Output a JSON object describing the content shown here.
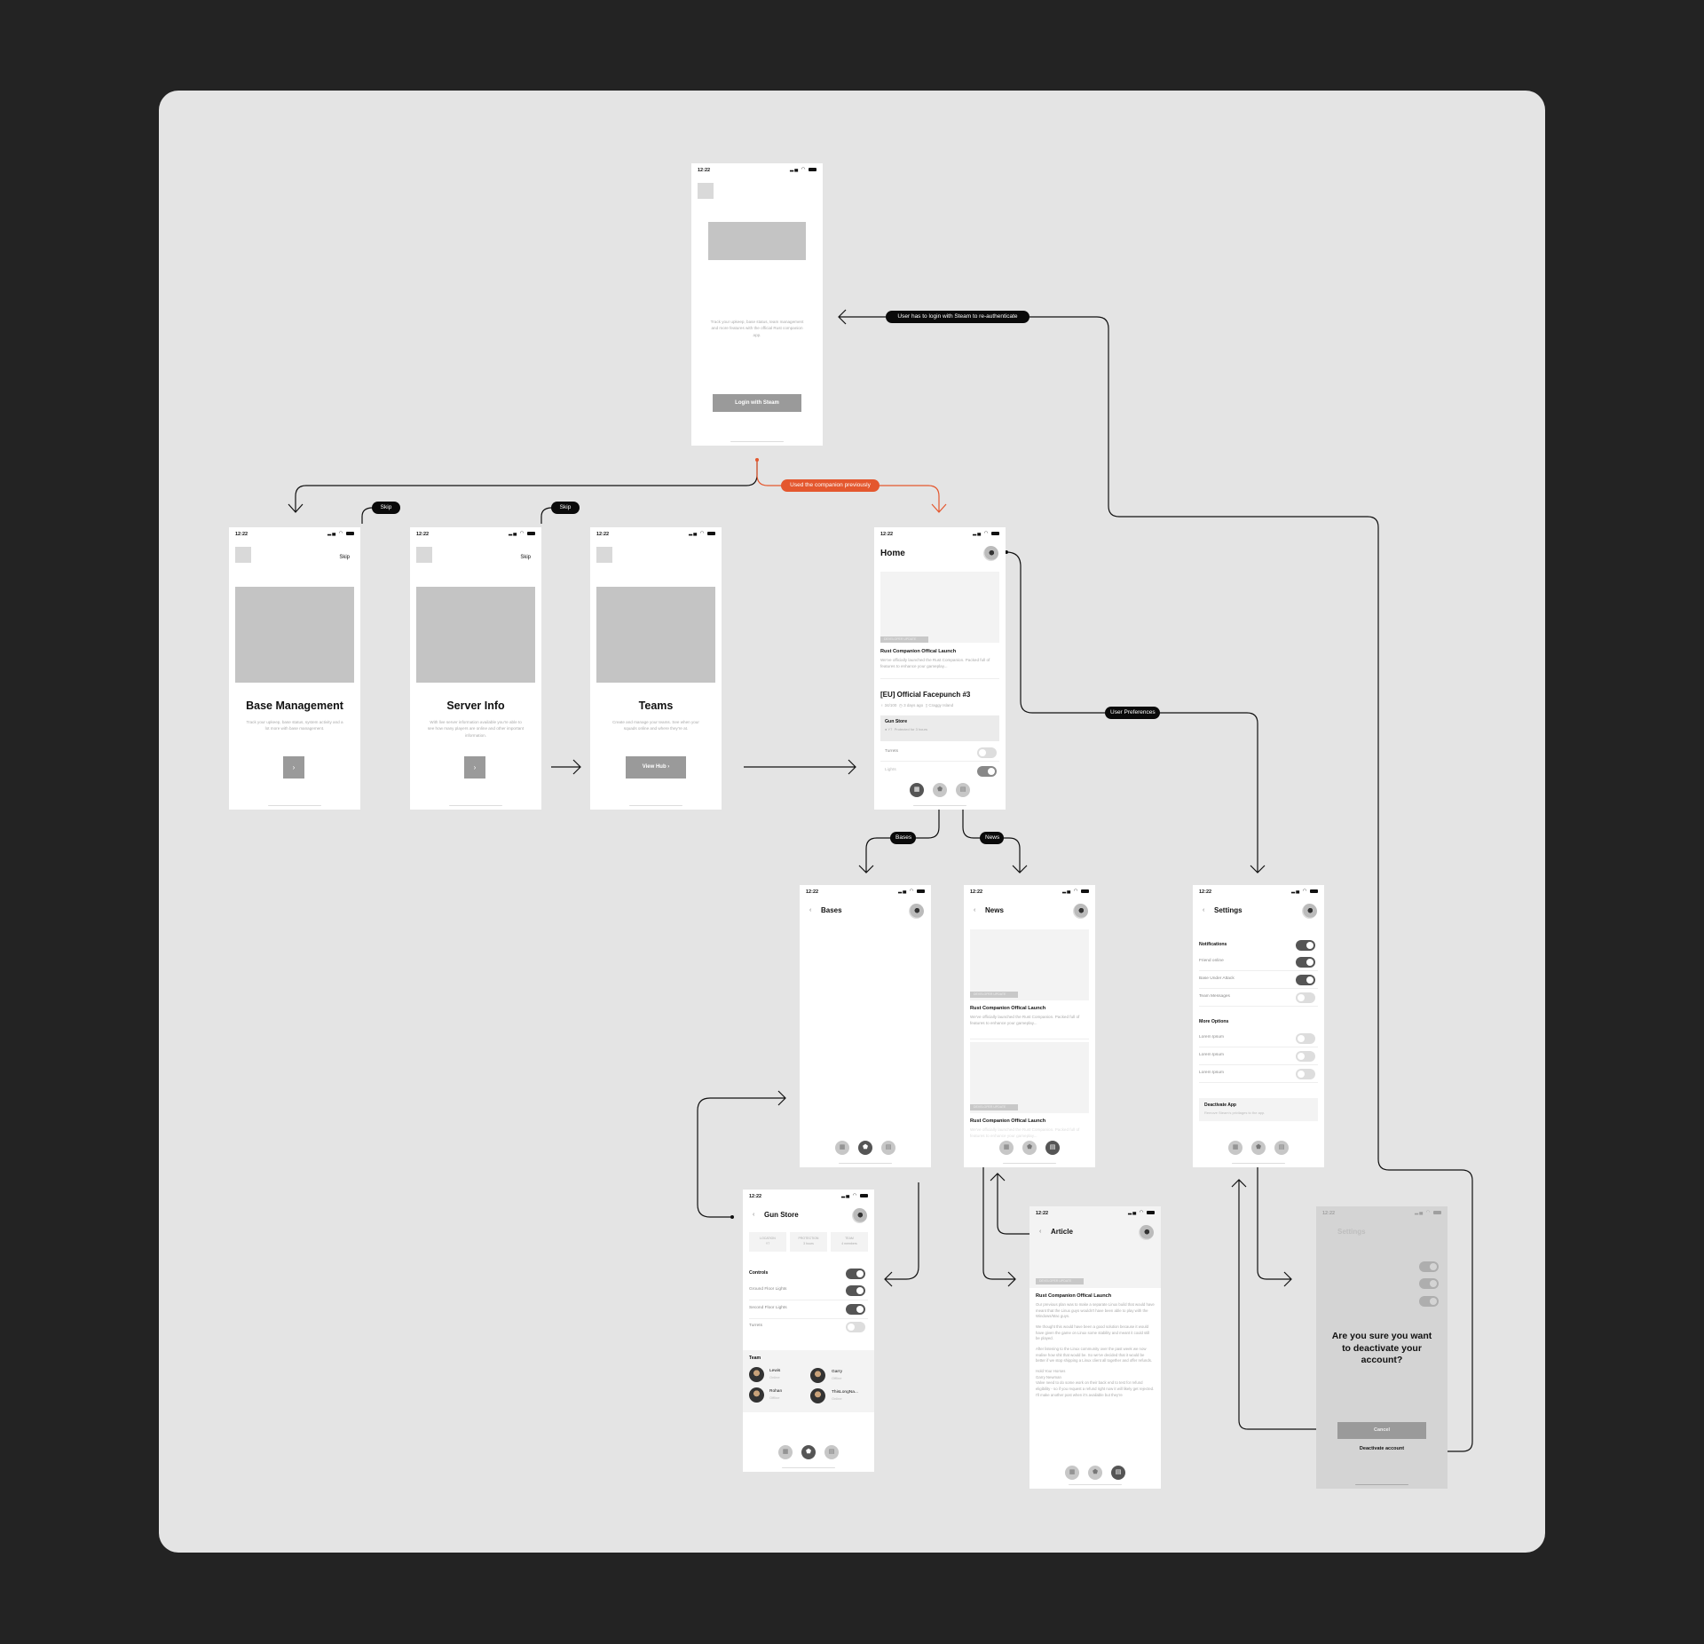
{
  "status_time": "12:22",
  "colors": {
    "background": "#232323",
    "board": "#e4e4e4",
    "accent": "#e4572e",
    "placeholder": "#c4c4c4",
    "button": "#9a9a9a"
  },
  "flow_labels": {
    "reauth": "User has to login with Steam to re-authenticate",
    "used_previously": "Used the companion previously",
    "skip1": "Skip",
    "skip2": "Skip",
    "user_preferences": "User Preferences",
    "bases": "Bases",
    "news": "News"
  },
  "login": {
    "description": "Track your upkeep, base status, team management and more features with the official Rust companion app.",
    "button": "Login with Steam"
  },
  "onboarding": [
    {
      "skip": "Skip",
      "title": "Base Management",
      "description": "Track your upkeep, base status, system activity and a lot more with base management.",
      "button": "›"
    },
    {
      "skip": "Skip",
      "title": "Server Info",
      "description": "With live server information available you're able to see how many players are online and other important information.",
      "button": "›"
    },
    {
      "title": "Teams",
      "description": "Create and manage your teams. See when your squads online and where they're at.",
      "button": "View Hub ›"
    }
  ],
  "home": {
    "title": "Home",
    "news_tag": "DEVELOPER UPDATE",
    "news_title": "Rust Companion Offical Launch",
    "news_desc": "We've officially launched the Rust Companion. Packed full of features to enhance your gameplay...",
    "server_title": "[EU] Official Facepunch #3",
    "server_players": "34/100",
    "server_wipe": "3 days ago",
    "server_map": "Craggy Island",
    "base_name": "Gun Store",
    "base_grid": "Y7",
    "base_protection": "Protected for 3 hours",
    "controls": [
      {
        "label": "Turrets",
        "on": false
      },
      {
        "label": "Lights",
        "on": true
      }
    ]
  },
  "nav_icons": [
    "dashboard-icon",
    "base-shield-icon",
    "news-icon"
  ],
  "bases": {
    "title": "Bases"
  },
  "news": {
    "title": "News",
    "items": [
      {
        "tag": "DEVELOPER UPDATE",
        "title": "Rust Companion Offical Launch",
        "desc": "We've officially launched the Rust Companion. Packed full of features to enhance your gameplay..."
      },
      {
        "tag": "DEVELOPER UPDATE",
        "title": "Rust Companion Offical Launch",
        "desc": "We've officially launched the Rust Companion. Packed full of features to enhance your gameplay..."
      }
    ]
  },
  "settings": {
    "title": "Settings",
    "notifications": "Notifications",
    "notifications_on": true,
    "notif_rows": [
      {
        "label": "Friend online",
        "on": true
      },
      {
        "label": "Base Under Attack",
        "on": true
      },
      {
        "label": "Team Messages",
        "on": false
      }
    ],
    "more": "More Options",
    "more_rows": [
      {
        "label": "Lorem Ipsum",
        "on": false
      },
      {
        "label": "Lorem Ipsum",
        "on": false
      },
      {
        "label": "Lorem Ipsum",
        "on": false
      }
    ],
    "deactivate_title": "Deactivate App",
    "deactivate_desc": "Remove Steam's privilages to the app."
  },
  "gunstore": {
    "title": "Gun Store",
    "stats": [
      {
        "label": "LOCATION",
        "value": "Y7"
      },
      {
        "label": "PROTECTION",
        "value": "3 hours"
      },
      {
        "label": "TEAM",
        "value": "4 members"
      }
    ],
    "controls": "Controls",
    "controls_on": true,
    "rows": [
      {
        "label": "Ground Floor Lights",
        "on": true
      },
      {
        "label": "Second Floor Lights",
        "on": true
      },
      {
        "label": "Turrets",
        "on": false
      }
    ],
    "team_title": "Team",
    "members": [
      {
        "name": "Lewis",
        "status": "Online"
      },
      {
        "name": "Garry",
        "status": "Offline"
      },
      {
        "name": "Rohan",
        "status": "Offline"
      },
      {
        "name": "ThisLongNa...",
        "status": "Online"
      }
    ]
  },
  "article": {
    "title": "Article",
    "tag": "DEVELOPER UPDATE",
    "heading": "Rust Companion Offical Launch",
    "paragraphs": [
      "Our previous plan was to make a separate Linux build that would have meant that the Linux guys wouldn't have been able to play with the Windows/Mac guys.",
      "We thought this would have been a good solution because it would have given the game on Linux some stability and meant it could still be played.",
      "After listening to the Linux community over the past week we now realise how shit that would be. So we've decided that it would be better if we stop shipping a Linux client all together and offer refunds.",
      "Hold Your Horses\nGarry Newman\nValve need to do some work on their back end to test for refund eligibility - so if you request a refund right now it will likely get rejected. I'll make another post when it's available but they're"
    ]
  },
  "deactivate_modal": {
    "question": "Are you sure you want  to deactivate your account?",
    "cancel": "Cancel",
    "confirm": "Deactivate account"
  }
}
